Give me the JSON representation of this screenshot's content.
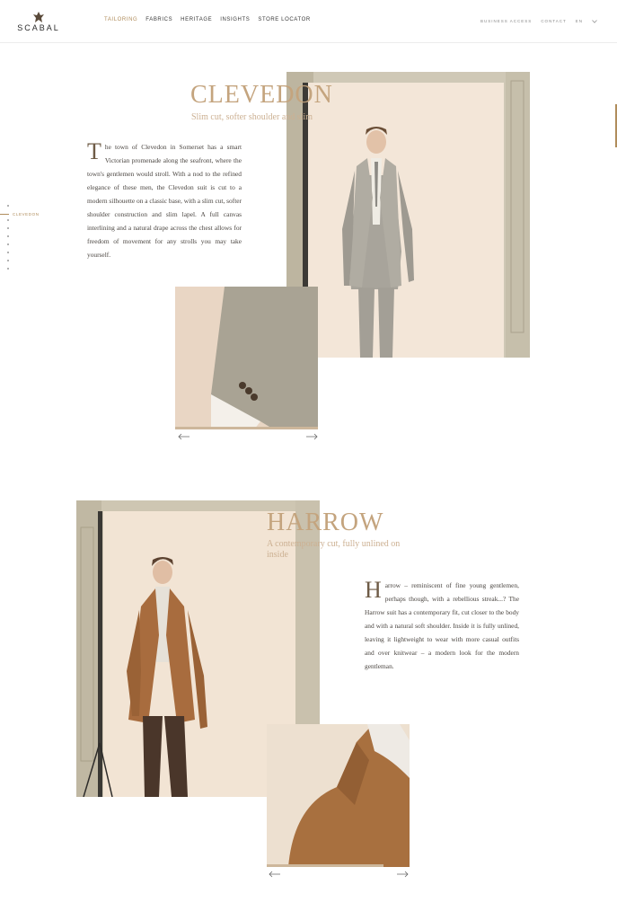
{
  "header": {
    "logo": "SCABAL",
    "nav": [
      "TAILORING",
      "FABRICS",
      "HERITAGE",
      "INSIGHTS",
      "STORE LOCATOR"
    ],
    "active_nav": "TAILORING",
    "business_access": "BUSINESS ACCESS",
    "contact": "CONTACT",
    "language": "EN"
  },
  "side_nav": {
    "active_label": "CLEVEDON"
  },
  "sections": [
    {
      "title": "CLEVEDON",
      "subtitle": "Slim cut, softer shoulder and slim",
      "drop_cap": "T",
      "body": "he town of Clevedon in Somerset has a smart Victorian promenade along the seafront, where the town's gentlemen would stroll. With a nod to the refined elegance of these men, the Clevedon suit is cut to a modern silhouette on a classic base, with a slim cut, softer shoulder construction and slim lapel. A full canvas interlining and a natural drape across the chest allows for freedom of movement for any strolls you may take yourself."
    },
    {
      "title": "HARROW",
      "subtitle": "A contemporary cut, fully unlined on inside",
      "drop_cap": "H",
      "body": "arrow – reminiscent of fine young gentlemen, perhaps though, with a rebellious streak...? The Harrow suit has a contemporary fit, cut closer to the body and with a natural soft shoulder. Inside it is fully unlined, leaving it lightweight to wear with more casual outfits and over knitwear – a modern look for the modern gentleman."
    }
  ],
  "colors": {
    "accent": "#b08d5c",
    "title": "#c4a47e",
    "backdrop": "#f1e4d6",
    "grey_suit": "#a9a59c",
    "tan_jacket": "#a86c3e"
  },
  "icons": [
    "arrow-left-icon",
    "arrow-right-icon",
    "chevron-down-icon",
    "crest-icon"
  ]
}
